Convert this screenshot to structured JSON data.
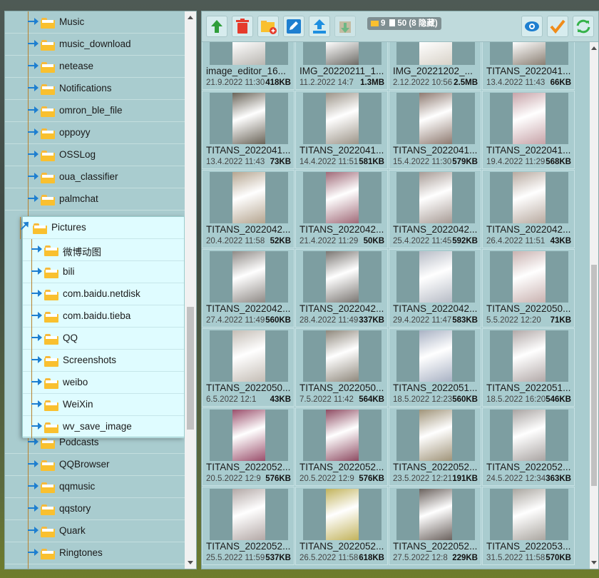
{
  "tree": {
    "items": [
      {
        "label": "Music",
        "level": 0
      },
      {
        "label": "music_download",
        "level": 0
      },
      {
        "label": "netease",
        "level": 0
      },
      {
        "label": "Notifications",
        "level": 0
      },
      {
        "label": "omron_ble_file",
        "level": 0
      },
      {
        "label": "oppoyy",
        "level": 0
      },
      {
        "label": "OSSLog",
        "level": 0
      },
      {
        "label": "oua_classifier",
        "level": 0
      },
      {
        "label": "palmchat",
        "level": 0
      }
    ],
    "expanded": {
      "label": "Pictures",
      "children": [
        {
          "label": "微博动图"
        },
        {
          "label": "bili"
        },
        {
          "label": "com.baidu.netdisk"
        },
        {
          "label": "com.baidu.tieba"
        },
        {
          "label": "QQ"
        },
        {
          "label": "Screenshots"
        },
        {
          "label": "weibo"
        },
        {
          "label": "WeiXin"
        },
        {
          "label": "wv_save_image"
        }
      ]
    },
    "after": [
      {
        "label": "Podcasts"
      },
      {
        "label": "QQBrowser"
      },
      {
        "label": "qqmusic"
      },
      {
        "label": "qqstory"
      },
      {
        "label": "Quark"
      },
      {
        "label": "Ringtones"
      }
    ]
  },
  "toolbar": {
    "buttons": [
      "up-icon",
      "delete-icon",
      "new-folder-icon",
      "rename-icon",
      "upload-icon",
      "download-icon"
    ],
    "right_buttons": [
      "eye-icon",
      "check-icon",
      "refresh-icon"
    ],
    "folder_count": "9",
    "file_count": "50",
    "hidden_text": "(8 隐藏)"
  },
  "files": [
    {
      "name": "image_editor_16...",
      "date": "21.9.2022 11:30",
      "size": "418KB",
      "color": "#b9b6b1"
    },
    {
      "name": "IMG_20220211_1...",
      "date": "11.2.2022 14:7",
      "size": "1.3MB",
      "color": "#6d6b66"
    },
    {
      "name": "IMG_20221202_...",
      "date": "2.12.2022 10:56",
      "size": "2.5MB",
      "color": "#d8d2c8"
    },
    {
      "name": "TITANS_2022041...",
      "date": "13.4.2022 11:43",
      "size": "66KB",
      "color": "#8a7f73"
    },
    {
      "name": "TITANS_2022041...",
      "date": "13.4.2022 11:43",
      "size": "73KB",
      "color": "#6a6458"
    },
    {
      "name": "TITANS_2022041...",
      "date": "14.4.2022 11:51",
      "size": "581KB",
      "color": "#9c9488"
    },
    {
      "name": "TITANS_2022041...",
      "date": "15.4.2022 11:30",
      "size": "579KB",
      "color": "#8e7a70"
    },
    {
      "name": "TITANS_2022041...",
      "date": "19.4.2022 11:29",
      "size": "568KB",
      "color": "#c7a3a8"
    },
    {
      "name": "TITANS_2022042...",
      "date": "20.4.2022 11:58",
      "size": "52KB",
      "color": "#b5a590"
    },
    {
      "name": "TITANS_2022042...",
      "date": "21.4.2022 11:29",
      "size": "50KB",
      "color": "#a06a78"
    },
    {
      "name": "TITANS_2022042...",
      "date": "25.4.2022 11:45",
      "size": "592KB",
      "color": "#a79b95"
    },
    {
      "name": "TITANS_2022042...",
      "date": "26.4.2022 11:51",
      "size": "43KB",
      "color": "#b8aaa0"
    },
    {
      "name": "TITANS_2022042...",
      "date": "27.4.2022 11:49",
      "size": "560KB",
      "color": "#8f8a86"
    },
    {
      "name": "TITANS_2022042...",
      "date": "28.4.2022 11:49",
      "size": "337KB",
      "color": "#7a7672"
    },
    {
      "name": "TITANS_2022042...",
      "date": "29.4.2022 11:47",
      "size": "583KB",
      "color": "#b7bcc6"
    },
    {
      "name": "TITANS_2022050...",
      "date": "5.5.2022 12:20",
      "size": "71KB",
      "color": "#c9b2b0"
    },
    {
      "name": "TITANS_2022050...",
      "date": "6.5.2022 12:1",
      "size": "43KB",
      "color": "#c4bdb5"
    },
    {
      "name": "TITANS_2022050...",
      "date": "7.5.2022 11:42",
      "size": "564KB",
      "color": "#8f887c"
    },
    {
      "name": "TITANS_2022051...",
      "date": "18.5.2022 12:23",
      "size": "560KB",
      "color": "#a9b2c4"
    },
    {
      "name": "TITANS_2022051...",
      "date": "18.5.2022 16:20",
      "size": "546KB",
      "color": "#b2a9a8"
    },
    {
      "name": "TITANS_2022052...",
      "date": "20.5.2022 12:9",
      "size": "576KB",
      "color": "#9a4e6b"
    },
    {
      "name": "TITANS_2022052...",
      "date": "20.5.2022 12:9",
      "size": "576KB",
      "color": "#8e4b62"
    },
    {
      "name": "TITANS_2022052...",
      "date": "23.5.2022 12:21",
      "size": "191KB",
      "color": "#a09479"
    },
    {
      "name": "TITANS_2022052...",
      "date": "24.5.2022 12:34",
      "size": "363KB",
      "color": "#a9a4a2"
    },
    {
      "name": "TITANS_2022052...",
      "date": "25.5.2022 11:59",
      "size": "537KB",
      "color": "#b3a8a6"
    },
    {
      "name": "TITANS_2022052...",
      "date": "26.5.2022 11:58",
      "size": "618KB",
      "color": "#c2b35c"
    },
    {
      "name": "TITANS_2022052...",
      "date": "27.5.2022 12:8",
      "size": "229KB",
      "color": "#6b625e"
    },
    {
      "name": "TITANS_2022053...",
      "date": "31.5.2022 11:58",
      "size": "570KB",
      "color": "#aaa6a0"
    }
  ]
}
